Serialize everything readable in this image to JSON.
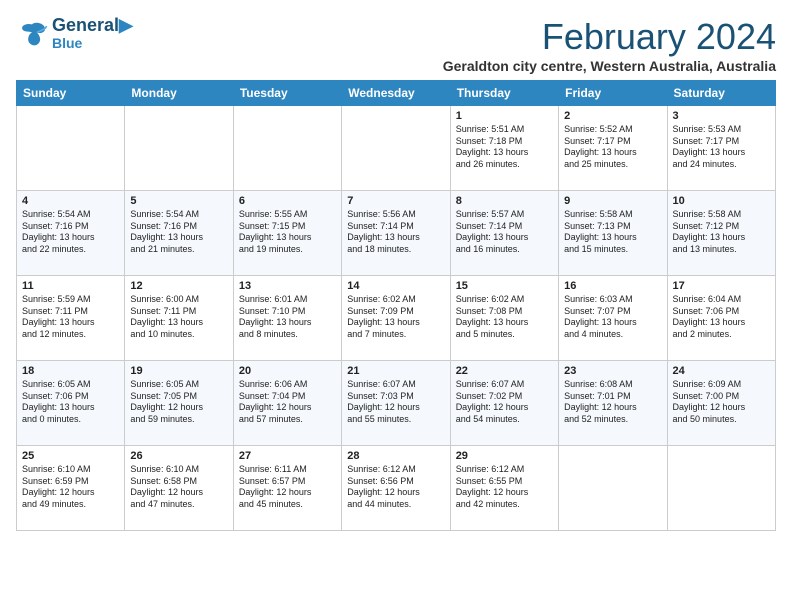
{
  "logo": {
    "line1": "General",
    "line2": "Blue"
  },
  "title": "February 2024",
  "subtitle": "Geraldton city centre, Western Australia, Australia",
  "days_of_week": [
    "Sunday",
    "Monday",
    "Tuesday",
    "Wednesday",
    "Thursday",
    "Friday",
    "Saturday"
  ],
  "weeks": [
    [
      {
        "day": "",
        "info": ""
      },
      {
        "day": "",
        "info": ""
      },
      {
        "day": "",
        "info": ""
      },
      {
        "day": "",
        "info": ""
      },
      {
        "day": "1",
        "info": "Sunrise: 5:51 AM\nSunset: 7:18 PM\nDaylight: 13 hours\nand 26 minutes."
      },
      {
        "day": "2",
        "info": "Sunrise: 5:52 AM\nSunset: 7:17 PM\nDaylight: 13 hours\nand 25 minutes."
      },
      {
        "day": "3",
        "info": "Sunrise: 5:53 AM\nSunset: 7:17 PM\nDaylight: 13 hours\nand 24 minutes."
      }
    ],
    [
      {
        "day": "4",
        "info": "Sunrise: 5:54 AM\nSunset: 7:16 PM\nDaylight: 13 hours\nand 22 minutes."
      },
      {
        "day": "5",
        "info": "Sunrise: 5:54 AM\nSunset: 7:16 PM\nDaylight: 13 hours\nand 21 minutes."
      },
      {
        "day": "6",
        "info": "Sunrise: 5:55 AM\nSunset: 7:15 PM\nDaylight: 13 hours\nand 19 minutes."
      },
      {
        "day": "7",
        "info": "Sunrise: 5:56 AM\nSunset: 7:14 PM\nDaylight: 13 hours\nand 18 minutes."
      },
      {
        "day": "8",
        "info": "Sunrise: 5:57 AM\nSunset: 7:14 PM\nDaylight: 13 hours\nand 16 minutes."
      },
      {
        "day": "9",
        "info": "Sunrise: 5:58 AM\nSunset: 7:13 PM\nDaylight: 13 hours\nand 15 minutes."
      },
      {
        "day": "10",
        "info": "Sunrise: 5:58 AM\nSunset: 7:12 PM\nDaylight: 13 hours\nand 13 minutes."
      }
    ],
    [
      {
        "day": "11",
        "info": "Sunrise: 5:59 AM\nSunset: 7:11 PM\nDaylight: 13 hours\nand 12 minutes."
      },
      {
        "day": "12",
        "info": "Sunrise: 6:00 AM\nSunset: 7:11 PM\nDaylight: 13 hours\nand 10 minutes."
      },
      {
        "day": "13",
        "info": "Sunrise: 6:01 AM\nSunset: 7:10 PM\nDaylight: 13 hours\nand 8 minutes."
      },
      {
        "day": "14",
        "info": "Sunrise: 6:02 AM\nSunset: 7:09 PM\nDaylight: 13 hours\nand 7 minutes."
      },
      {
        "day": "15",
        "info": "Sunrise: 6:02 AM\nSunset: 7:08 PM\nDaylight: 13 hours\nand 5 minutes."
      },
      {
        "day": "16",
        "info": "Sunrise: 6:03 AM\nSunset: 7:07 PM\nDaylight: 13 hours\nand 4 minutes."
      },
      {
        "day": "17",
        "info": "Sunrise: 6:04 AM\nSunset: 7:06 PM\nDaylight: 13 hours\nand 2 minutes."
      }
    ],
    [
      {
        "day": "18",
        "info": "Sunrise: 6:05 AM\nSunset: 7:06 PM\nDaylight: 13 hours\nand 0 minutes."
      },
      {
        "day": "19",
        "info": "Sunrise: 6:05 AM\nSunset: 7:05 PM\nDaylight: 12 hours\nand 59 minutes."
      },
      {
        "day": "20",
        "info": "Sunrise: 6:06 AM\nSunset: 7:04 PM\nDaylight: 12 hours\nand 57 minutes."
      },
      {
        "day": "21",
        "info": "Sunrise: 6:07 AM\nSunset: 7:03 PM\nDaylight: 12 hours\nand 55 minutes."
      },
      {
        "day": "22",
        "info": "Sunrise: 6:07 AM\nSunset: 7:02 PM\nDaylight: 12 hours\nand 54 minutes."
      },
      {
        "day": "23",
        "info": "Sunrise: 6:08 AM\nSunset: 7:01 PM\nDaylight: 12 hours\nand 52 minutes."
      },
      {
        "day": "24",
        "info": "Sunrise: 6:09 AM\nSunset: 7:00 PM\nDaylight: 12 hours\nand 50 minutes."
      }
    ],
    [
      {
        "day": "25",
        "info": "Sunrise: 6:10 AM\nSunset: 6:59 PM\nDaylight: 12 hours\nand 49 minutes."
      },
      {
        "day": "26",
        "info": "Sunrise: 6:10 AM\nSunset: 6:58 PM\nDaylight: 12 hours\nand 47 minutes."
      },
      {
        "day": "27",
        "info": "Sunrise: 6:11 AM\nSunset: 6:57 PM\nDaylight: 12 hours\nand 45 minutes."
      },
      {
        "day": "28",
        "info": "Sunrise: 6:12 AM\nSunset: 6:56 PM\nDaylight: 12 hours\nand 44 minutes."
      },
      {
        "day": "29",
        "info": "Sunrise: 6:12 AM\nSunset: 6:55 PM\nDaylight: 12 hours\nand 42 minutes."
      },
      {
        "day": "",
        "info": ""
      },
      {
        "day": "",
        "info": ""
      }
    ]
  ]
}
